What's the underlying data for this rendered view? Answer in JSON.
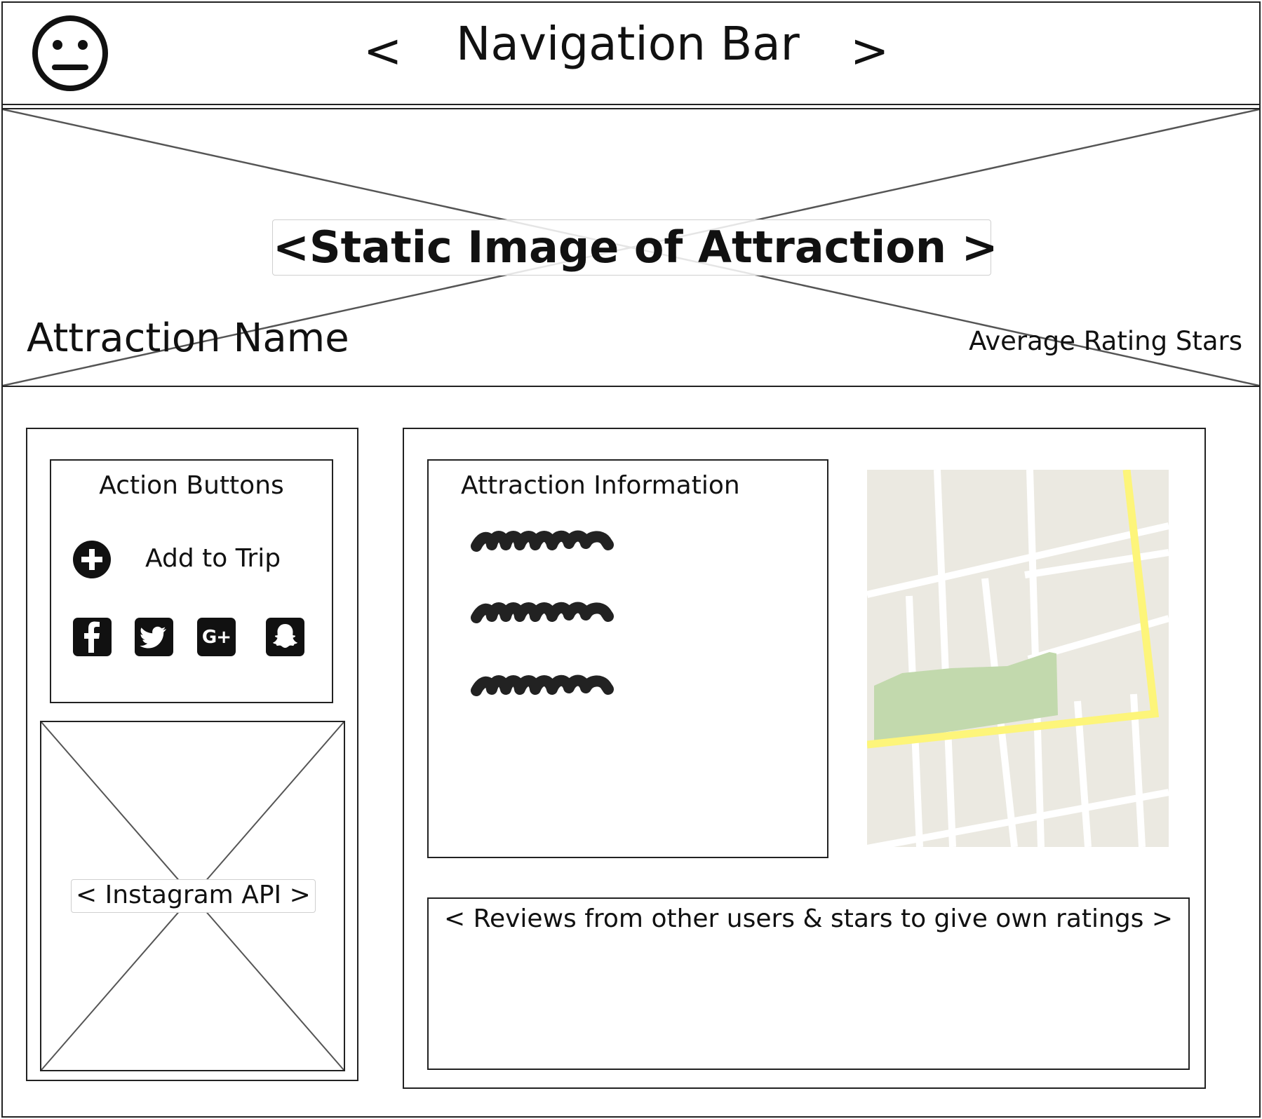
{
  "navbar": {
    "logo_icon": "neutral-face-icon",
    "prev_label": "<",
    "title": "Navigation Bar",
    "next_label": ">"
  },
  "hero": {
    "placeholder_label": "<Static Image of Attraction >",
    "attraction_name": "Attraction Name",
    "rating_label": "Average Rating Stars"
  },
  "actions": {
    "title": "Action Buttons",
    "add_to_trip_label": "Add to Trip",
    "add_icon": "plus-circle-icon",
    "social_icons": [
      "facebook-icon",
      "twitter-icon",
      "google-plus-icon",
      "snapchat-icon"
    ]
  },
  "instagram": {
    "placeholder_label": "< Instagram API >"
  },
  "info": {
    "title": "Attraction Information"
  },
  "map": {
    "icon": "map-icon",
    "colors": {
      "land": "#ebe9e1",
      "road": "#ffffff",
      "highway": "#fdf57a",
      "park": "#c2d9ad"
    }
  },
  "reviews": {
    "placeholder_label": "< Reviews from other users & stars to give own ratings >"
  }
}
